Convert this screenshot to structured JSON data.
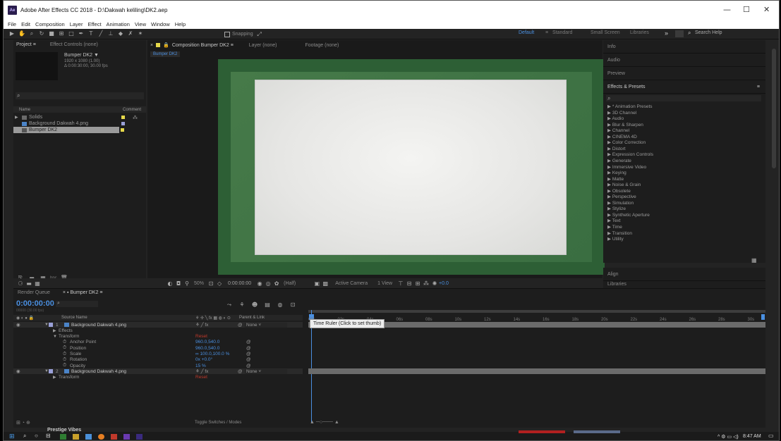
{
  "titlebar": {
    "app_icon": "Ae",
    "title": "Adobe After Effects CC 2018 - D:\\Dakwah keliling\\DK2.aep",
    "minimize": "—",
    "maximize": "☐",
    "close": "✕"
  },
  "menu": [
    "File",
    "Edit",
    "Composition",
    "Layer",
    "Effect",
    "Animation",
    "View",
    "Window",
    "Help"
  ],
  "toolbar": {
    "snapping": "Snapping",
    "workspaces": [
      "Default",
      "Standard",
      "Small Screen",
      "Libraries"
    ],
    "search_placeholder": "Search Help",
    "more": "»"
  },
  "project": {
    "tabs": [
      "Project",
      "Effect Controls (none)"
    ],
    "comp_name": "Bumper DK2 ▼",
    "comp_size": "1920 x 1080 (1.00)",
    "comp_duration": "Δ 0:00:30:00, 30.00 fps",
    "search_icon": "⌕",
    "col_name": "Name",
    "col_comment": "Comment",
    "items": [
      {
        "name": "Solids",
        "type": "folder"
      },
      {
        "name": "Background Dakwah 4.png",
        "type": "file"
      },
      {
        "name": "Bumper DK2",
        "type": "comp"
      }
    ],
    "footer": "bpc"
  },
  "comp": {
    "tab": "Composition Bumper DK2",
    "layer_tab": "Layer (none)",
    "footage_tab": "Footage (none)",
    "sub_tab": "Bumper DK2",
    "bar": {
      "zoom": "50%",
      "timecode": "0:00:00:00",
      "resolution": "(Half)",
      "camera": "Active Camera",
      "view": "1 View",
      "exposure": "+0.0"
    }
  },
  "right": {
    "panels": [
      "Info",
      "Audio",
      "Preview"
    ],
    "effects_title": "Effects & Presets",
    "search_icon": "⌕",
    "effects": [
      "* Animation Presets",
      "3D Channel",
      "Audio",
      "Blur & Sharpen",
      "Channel",
      "CINEMA 4D",
      "Color Correction",
      "Distort",
      "Expression Controls",
      "Generate",
      "Immersive Video",
      "Keying",
      "Matte",
      "Noise & Grain",
      "Obsolete",
      "Perspective",
      "Simulation",
      "Stylize",
      "Synthetic Aperture",
      "Text",
      "Time",
      "Transition",
      "Utility"
    ],
    "align": "Align",
    "libraries": "Libraries"
  },
  "timeline": {
    "tabs": [
      "Render Queue",
      "Bumper DK2"
    ],
    "timecode": "0:00:00:00",
    "frames": "00000 (30.00 fps)",
    "header": {
      "source": "Source Name",
      "parent": "Parent & Link"
    },
    "layers": [
      {
        "num": "1",
        "name": "Background Dakwah 4.png",
        "parent": "None"
      },
      {
        "indent": 1,
        "name": "Effects"
      },
      {
        "indent": 1,
        "name": "Transform",
        "value": "Reset"
      },
      {
        "indent": 2,
        "name": "Anchor Point",
        "value": "960.0,540.0"
      },
      {
        "indent": 2,
        "name": "Position",
        "value": "960.0,540.0"
      },
      {
        "indent": 2,
        "name": "Scale",
        "value": "∞ 100.0,100.0 %"
      },
      {
        "indent": 2,
        "name": "Rotation",
        "value": "0x +0.0°"
      },
      {
        "indent": 2,
        "name": "Opacity",
        "value": "15 %"
      },
      {
        "num": "2",
        "name": "Background Dakwah 4.png",
        "parent": "None"
      },
      {
        "indent": 1,
        "name": "Transform",
        "value": "Reset"
      }
    ],
    "ticks": [
      "00s",
      "02s",
      "04s",
      "06s",
      "08s",
      "10s",
      "12s",
      "14s",
      "16s",
      "18s",
      "20s",
      "22s",
      "24s",
      "26s",
      "28s",
      "30s"
    ],
    "tooltip": "Time Ruler (Click to set thumb)",
    "toggle": "Toggle Switches / Modes"
  },
  "taskbar": {
    "time": "8:47 AM",
    "prestige": "Prestige Vibes"
  }
}
